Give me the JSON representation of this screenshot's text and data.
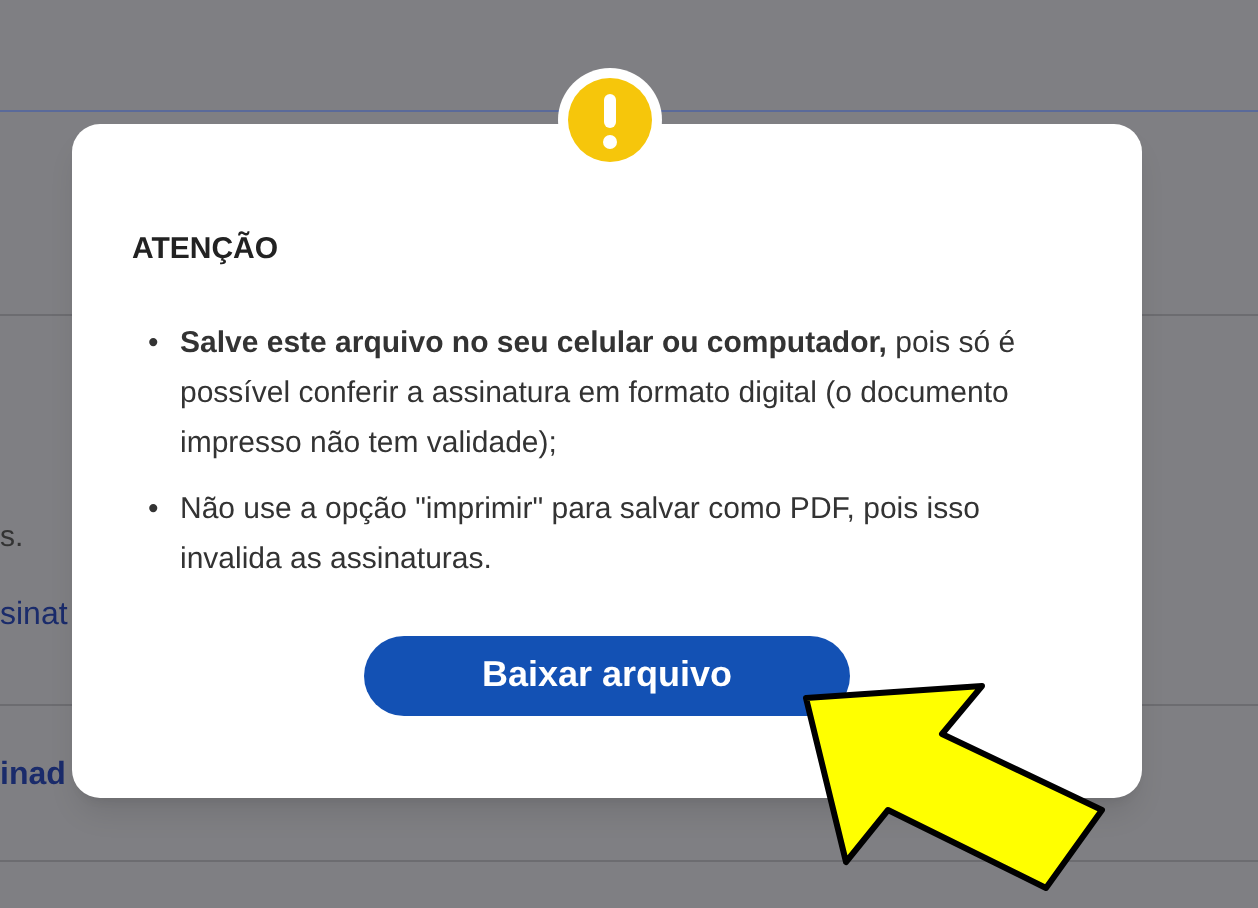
{
  "background": {
    "texts": [
      {
        "text": "s.",
        "kind": "plain"
      },
      {
        "text": "sinat",
        "kind": "link"
      },
      {
        "text": "inad",
        "kind": "link"
      }
    ]
  },
  "dialog": {
    "title": "ATENÇÃO",
    "items": [
      {
        "marker": "•",
        "text": "**Salve este arquivo no seu celular ou computador,** pois só é possível conferir a assinatura em formato digital (o documento impresso não tem validade);"
      },
      {
        "marker": "•",
        "text": "Não use a opção \"imprimir\" para salvar como PDF, pois isso invalida as assinaturas."
      }
    ],
    "button": "Baixar arquivo"
  }
}
